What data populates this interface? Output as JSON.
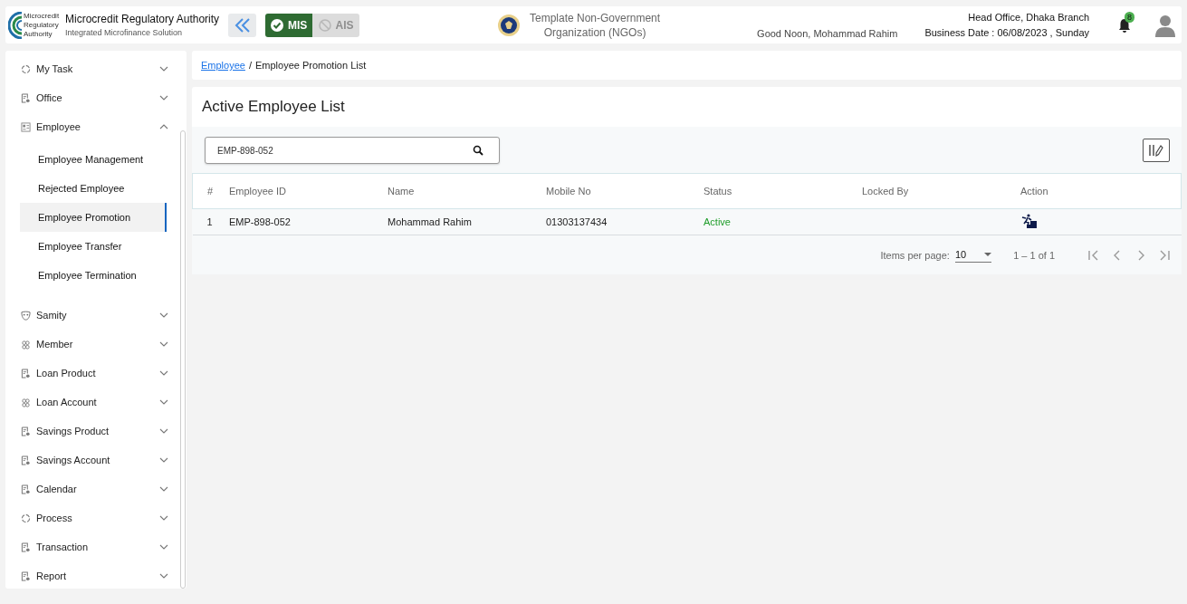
{
  "header": {
    "org_name": "Microcredit Regulatory Authority",
    "org_subtitle": "Integrated Microfinance Solution",
    "logo_text": [
      "Microcredit",
      "Regulatory",
      "Authority"
    ],
    "modes": [
      {
        "label": "MIS",
        "selected": true
      },
      {
        "label": "AIS",
        "selected": false
      }
    ],
    "ngo_name": [
      "Template Non-Government",
      "Organization (NGOs)"
    ],
    "greeting": "Good Noon, Mohammad Rahim",
    "office": "Head Office, Dhaka Branch",
    "business_date": "Business Date : 06/08/2023 , Sunday",
    "notification_count": "8"
  },
  "sidebar": {
    "items": [
      {
        "label": "My Task",
        "kind": "cycle",
        "expanded": false
      },
      {
        "label": "Office",
        "kind": "document",
        "expanded": false
      },
      {
        "label": "Employee",
        "kind": "badge",
        "expanded": true,
        "children": [
          {
            "label": "Employee Management",
            "selected": false
          },
          {
            "label": "Rejected Employee",
            "selected": false
          },
          {
            "label": "Employee Promotion",
            "selected": true
          },
          {
            "label": "Employee Transfer",
            "selected": false
          },
          {
            "label": "Employee Termination",
            "selected": false
          }
        ]
      },
      {
        "label": "Samity",
        "kind": "mask",
        "expanded": false
      },
      {
        "label": "Member",
        "kind": "group",
        "expanded": false
      },
      {
        "label": "Loan Product",
        "kind": "document",
        "expanded": false
      },
      {
        "label": "Loan Account",
        "kind": "group",
        "expanded": false
      },
      {
        "label": "Savings Product",
        "kind": "document",
        "expanded": false
      },
      {
        "label": "Savings Account",
        "kind": "document",
        "expanded": false
      },
      {
        "label": "Calendar",
        "kind": "document",
        "expanded": false
      },
      {
        "label": "Process",
        "kind": "cycle",
        "expanded": false
      },
      {
        "label": "Transaction",
        "kind": "document",
        "expanded": false
      },
      {
        "label": "Report",
        "kind": "document",
        "expanded": false
      }
    ]
  },
  "breadcrumb": {
    "link": "Employee",
    "separator": "/",
    "current": "Employee Promotion List"
  },
  "card": {
    "title": "Active Employee List",
    "search": {
      "value": "EMP-898-052"
    },
    "table": {
      "columns": [
        "#",
        "Employee ID",
        "Name",
        "Mobile No",
        "Status",
        "Locked By",
        "Action"
      ],
      "rows": [
        {
          "cells": [
            "1",
            "EMP-898-052",
            "Mohammad Rahim",
            "01303137434",
            "Active",
            ""
          ]
        }
      ]
    },
    "paginator": {
      "label": "Items per page:",
      "page_size": "10",
      "range": "1 – 1 of 1"
    }
  }
}
